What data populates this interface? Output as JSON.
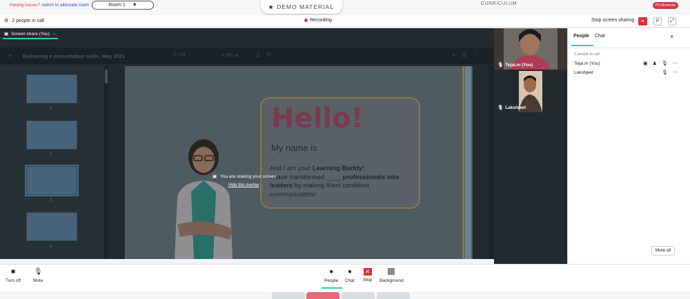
{
  "topbar": {
    "issue_text": "Having issues?",
    "issue_link": "switch to alternate room",
    "room_label": "Room 1",
    "demo_label": "DEMO MATERIAL",
    "curriculum_label": "CURRICULUM",
    "badge_label": "PS Momente"
  },
  "callbar": {
    "people_count": "2 people in call",
    "recording": "Recording",
    "stop_sharing": "Stop screen sharing",
    "close_symbol": "×",
    "p_label": "P",
    "expand_symbol": "⤢"
  },
  "share": {
    "tab_label": "Screen share (You)",
    "tab_dots": "···",
    "pdf_title": "Delivering a presentation skills_May 2023",
    "page_current": "3",
    "page_total": "/ 101",
    "zoom": "50%",
    "thumb_numbers": [
      "1",
      "2",
      "3",
      "4"
    ],
    "overlay_message": "You are sharing your screen",
    "overlay_link": "Hide this overlay"
  },
  "slide": {
    "hello": "Hello!",
    "my_name": "My name is",
    "line1_a": "And I am your ",
    "line1_b": "Learning Buddy",
    "line1_c": "!",
    "line2_a": "I have transformed ____ ",
    "line2_b": "professionals into",
    "line3_a": "leaders",
    "line3_b": " by making them confident",
    "line4": "communicators!"
  },
  "videos": [
    {
      "name": "Tejal.m (You)"
    },
    {
      "name": "Lakshjeet"
    }
  ],
  "panel": {
    "tab_people": "People",
    "tab_chat": "Chat",
    "close_symbol": "×",
    "count": "2 people in call",
    "members": [
      {
        "name": "Tejal.m (You)"
      },
      {
        "name": "Lakshjeet"
      }
    ],
    "mute_all": "Mute all"
  },
  "controls": {
    "turn_off": "Turn off",
    "mute": "Mute",
    "people": "People",
    "chat": "Chat",
    "stop": "Stop",
    "background": "Background"
  },
  "colors": {
    "accent": "#2fd1b0",
    "danger": "#e02d3f",
    "dark_bg": "#222a30"
  }
}
